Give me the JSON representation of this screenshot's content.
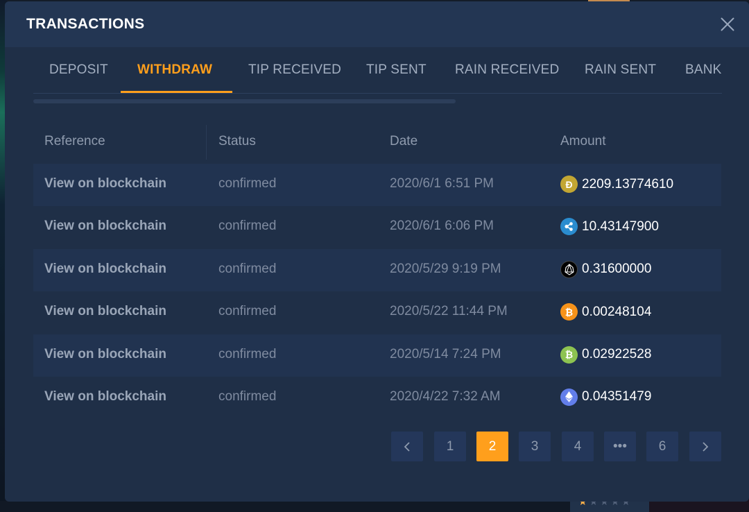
{
  "modal": {
    "title": "TRANSACTIONS",
    "close_icon": "close-icon"
  },
  "tabs": [
    {
      "label": "DEPOSIT",
      "active": false
    },
    {
      "label": "WITHDRAW",
      "active": true
    },
    {
      "label": "TIP RECEIVED",
      "active": false
    },
    {
      "label": "TIP SENT",
      "active": false
    },
    {
      "label": "RAIN RECEIVED",
      "active": false
    },
    {
      "label": "RAIN SENT",
      "active": false
    },
    {
      "label": "BANK",
      "active": false
    }
  ],
  "table": {
    "headers": [
      "Reference",
      "Status",
      "Date",
      "Amount"
    ],
    "rows": [
      {
        "reference": "View on blockchain",
        "status": "confirmed",
        "date": "2020/6/1 6:51 PM",
        "coin": "doge-icon",
        "amount": "2209.13774610"
      },
      {
        "reference": "View on blockchain",
        "status": "confirmed",
        "date": "2020/6/1 6:06 PM",
        "coin": "xrp-icon",
        "amount": "10.43147900"
      },
      {
        "reference": "View on blockchain",
        "status": "confirmed",
        "date": "2020/5/29 9:19 PM",
        "coin": "eos-icon",
        "amount": "0.31600000"
      },
      {
        "reference": "View on blockchain",
        "status": "confirmed",
        "date": "2020/5/22 11:44 PM",
        "coin": "btc-icon",
        "amount": "0.00248104"
      },
      {
        "reference": "View on blockchain",
        "status": "confirmed",
        "date": "2020/5/14 7:24 PM",
        "coin": "bch-icon",
        "amount": "0.02922528"
      },
      {
        "reference": "View on blockchain",
        "status": "confirmed",
        "date": "2020/4/22 7:32 AM",
        "coin": "eth-icon",
        "amount": "0.04351479"
      }
    ]
  },
  "pagination": {
    "prev_icon": "chevron-left-icon",
    "pages": [
      "1",
      "2",
      "3",
      "4",
      "•••",
      "6"
    ],
    "current_page": "2",
    "next_icon": "chevron-right-icon"
  },
  "colors": {
    "accent": "#ff9f1c",
    "modal_bg": "#1f2f47",
    "header_bg": "#233653",
    "doge": "#c2a633",
    "xrp": "#2a8ccf",
    "eos": "#000000",
    "btc": "#f7931a",
    "bch": "#8dc351",
    "eth": "#627eea"
  }
}
